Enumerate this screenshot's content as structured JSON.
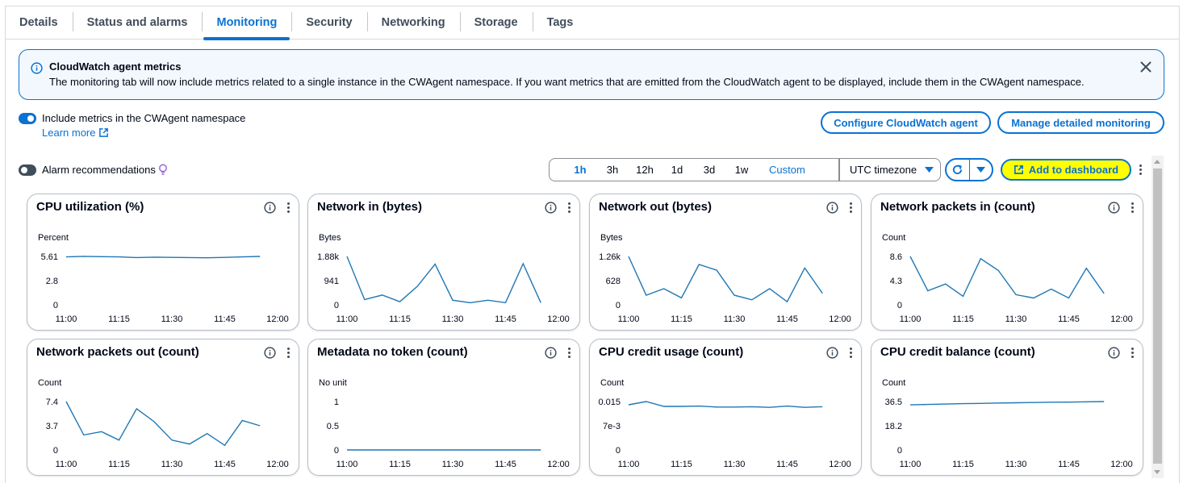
{
  "tabs": [
    {
      "label": "Details",
      "active": false
    },
    {
      "label": "Status and alarms",
      "active": false
    },
    {
      "label": "Monitoring",
      "active": true
    },
    {
      "label": "Security",
      "active": false
    },
    {
      "label": "Networking",
      "active": false
    },
    {
      "label": "Storage",
      "active": false
    },
    {
      "label": "Tags",
      "active": false
    }
  ],
  "banner": {
    "title": "CloudWatch agent metrics",
    "text": "The monitoring tab will now include metrics related to a single instance in the CWAgent namespace. If you want metrics that are emitted from the CloudWatch agent to be displayed, include them in the CWAgent namespace.",
    "icon": "info-icon",
    "close_icon": "close-icon"
  },
  "cwagent_toggle": {
    "label": "Include metrics in the CWAgent namespace",
    "checked": true
  },
  "learn_more": "Learn more",
  "configure_button": "Configure CloudWatch agent",
  "manage_button": "Manage detailed monitoring",
  "alarm_toggle": {
    "label": "Alarm recommendations",
    "checked": false
  },
  "time_range": {
    "options": [
      "1h",
      "3h",
      "12h",
      "1d",
      "3d",
      "1w"
    ],
    "selected": "1h",
    "custom_label": "Custom"
  },
  "timezone": "UTC timezone",
  "add_dashboard": "Add to dashboard",
  "colors": {
    "accent": "#0972d3",
    "line": "#1f77b4",
    "highlight": "#ffff00"
  },
  "chart_data": [
    {
      "type": "line",
      "title": "CPU utilization (%)",
      "ylabel": "Percent",
      "yticks": [
        "5.61",
        "2.8",
        "0"
      ],
      "ylim": [
        0,
        5.61
      ],
      "xticks": [
        "11:00",
        "11:15",
        "11:30",
        "11:45",
        "12:00"
      ],
      "x": [
        "11:00",
        "11:05",
        "11:10",
        "11:15",
        "11:20",
        "11:25",
        "11:30",
        "11:35",
        "11:40",
        "11:45",
        "11:50",
        "11:55"
      ],
      "values": [
        5.55,
        5.62,
        5.58,
        5.55,
        5.48,
        5.53,
        5.5,
        5.48,
        5.45,
        5.5,
        5.55,
        5.61
      ]
    },
    {
      "type": "line",
      "title": "Network in (bytes)",
      "ylabel": "Bytes",
      "yticks": [
        "1.88k",
        "941",
        "0"
      ],
      "ylim": [
        0,
        1880
      ],
      "xticks": [
        "11:00",
        "11:15",
        "11:30",
        "11:45",
        "12:00"
      ],
      "x": [
        "11:00",
        "11:05",
        "11:10",
        "11:15",
        "11:20",
        "11:25",
        "11:30",
        "11:35",
        "11:40",
        "11:45",
        "11:50",
        "11:55"
      ],
      "values": [
        1880,
        200,
        380,
        120,
        720,
        1580,
        180,
        80,
        180,
        80,
        1600,
        80
      ]
    },
    {
      "type": "line",
      "title": "Network out (bytes)",
      "ylabel": "Bytes",
      "yticks": [
        "1.26k",
        "628",
        "0"
      ],
      "ylim": [
        0,
        1260
      ],
      "xticks": [
        "11:00",
        "11:15",
        "11:30",
        "11:45",
        "12:00"
      ],
      "x": [
        "11:00",
        "11:05",
        "11:10",
        "11:15",
        "11:20",
        "11:25",
        "11:30",
        "11:35",
        "11:40",
        "11:45",
        "11:50",
        "11:55"
      ],
      "values": [
        1260,
        250,
        420,
        180,
        1050,
        900,
        250,
        130,
        420,
        80,
        960,
        300
      ]
    },
    {
      "type": "line",
      "title": "Network packets in (count)",
      "ylabel": "Count",
      "yticks": [
        "8.6",
        "4.3",
        "0"
      ],
      "ylim": [
        0,
        8.6
      ],
      "xticks": [
        "11:00",
        "11:15",
        "11:30",
        "11:45",
        "12:00"
      ],
      "x": [
        "11:00",
        "11:05",
        "11:10",
        "11:15",
        "11:20",
        "11:25",
        "11:30",
        "11:35",
        "11:40",
        "11:45",
        "11:50",
        "11:55"
      ],
      "values": [
        8.6,
        2.5,
        3.7,
        1.5,
        8.2,
        6.1,
        1.8,
        1.2,
        2.8,
        1.2,
        6.5,
        2.0
      ]
    },
    {
      "type": "line",
      "title": "Network packets out (count)",
      "ylabel": "Count",
      "yticks": [
        "7.4",
        "3.7",
        "0"
      ],
      "ylim": [
        0,
        7.4
      ],
      "xticks": [
        "11:00",
        "11:15",
        "11:30",
        "11:45",
        "12:00"
      ],
      "x": [
        "11:00",
        "11:05",
        "11:10",
        "11:15",
        "11:20",
        "11:25",
        "11:30",
        "11:35",
        "11:40",
        "11:45",
        "11:50",
        "11:55"
      ],
      "values": [
        7.4,
        2.3,
        2.8,
        1.5,
        6.3,
        4.3,
        1.5,
        0.9,
        2.5,
        0.7,
        4.5,
        3.7
      ]
    },
    {
      "type": "line",
      "title": "Metadata no token (count)",
      "ylabel": "No unit",
      "yticks": [
        "1",
        "0.5",
        "0"
      ],
      "ylim": [
        0,
        1
      ],
      "xticks": [
        "11:00",
        "11:15",
        "11:30",
        "11:45",
        "12:00"
      ],
      "x": [
        "11:00",
        "11:05",
        "11:10",
        "11:15",
        "11:20",
        "11:25",
        "11:30",
        "11:35",
        "11:40",
        "11:45",
        "11:50",
        "11:55"
      ],
      "values": [
        0,
        0,
        0,
        0,
        0,
        0,
        0,
        0,
        0,
        0,
        0,
        0
      ]
    },
    {
      "type": "line",
      "title": "CPU credit usage (count)",
      "ylabel": "Count",
      "yticks": [
        "0.015",
        "7e-3",
        "0"
      ],
      "ylim": [
        0,
        0.015
      ],
      "xticks": [
        "11:00",
        "11:15",
        "11:30",
        "11:45",
        "12:00"
      ],
      "x": [
        "11:00",
        "11:05",
        "11:10",
        "11:15",
        "11:20",
        "11:25",
        "11:30",
        "11:35",
        "11:40",
        "11:45",
        "11:50",
        "11:55"
      ],
      "values": [
        0.014,
        0.015,
        0.0135,
        0.0135,
        0.0136,
        0.0133,
        0.0133,
        0.0134,
        0.0132,
        0.0136,
        0.0132,
        0.0134
      ]
    },
    {
      "type": "line",
      "title": "CPU credit balance (count)",
      "ylabel": "Count",
      "yticks": [
        "36.5",
        "18.2",
        "0"
      ],
      "ylim": [
        0,
        36.5
      ],
      "xticks": [
        "11:00",
        "11:15",
        "11:30",
        "11:45",
        "12:00"
      ],
      "x": [
        "11:00",
        "11:05",
        "11:10",
        "11:15",
        "11:20",
        "11:25",
        "11:30",
        "11:35",
        "11:40",
        "11:45",
        "11:50",
        "11:55"
      ],
      "values": [
        34.0,
        34.3,
        34.6,
        34.9,
        35.1,
        35.4,
        35.6,
        35.8,
        36.0,
        36.1,
        36.3,
        36.5
      ]
    }
  ]
}
